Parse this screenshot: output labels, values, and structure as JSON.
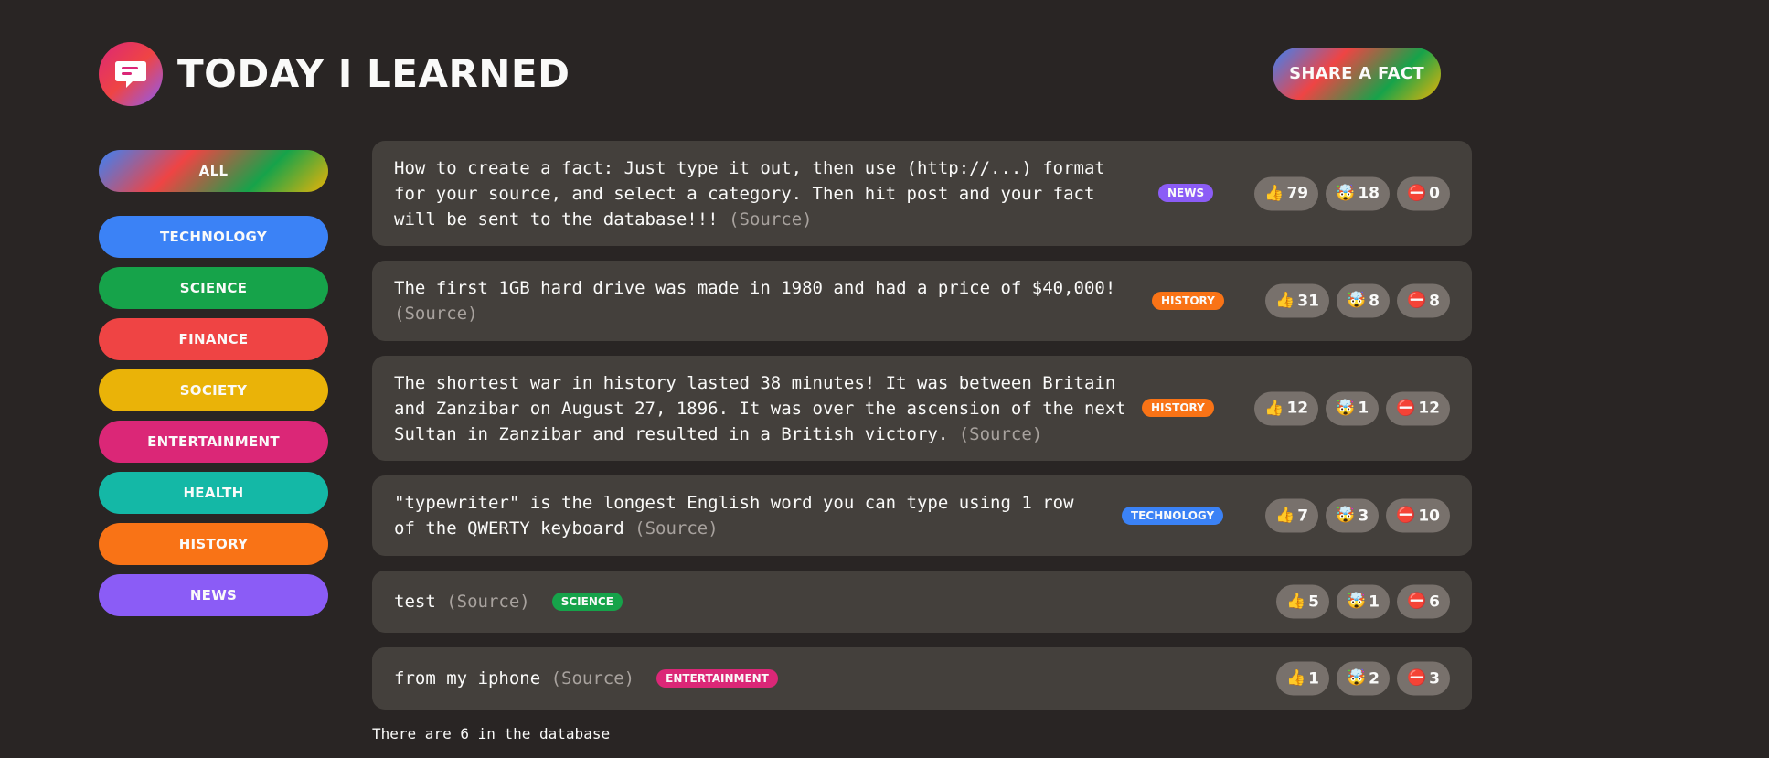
{
  "header": {
    "title": "TODAY I LEARNED",
    "share_button": "SHARE A FACT",
    "logo_icon": "speech-bubble-icon"
  },
  "categories": [
    {
      "name": "ALL",
      "color": "gradient"
    },
    {
      "name": "TECHNOLOGY",
      "color": "#3b82f6"
    },
    {
      "name": "SCIENCE",
      "color": "#16a34a"
    },
    {
      "name": "FINANCE",
      "color": "#ef4444"
    },
    {
      "name": "SOCIETY",
      "color": "#eab308"
    },
    {
      "name": "ENTERTAINMENT",
      "color": "#db2777"
    },
    {
      "name": "HEALTH",
      "color": "#14b8a6"
    },
    {
      "name": "HISTORY",
      "color": "#f97316"
    },
    {
      "name": "NEWS",
      "color": "#8b5cf6"
    }
  ],
  "facts": [
    {
      "text": "How to create a fact: Just type it out, then use (http://...) format for your source, and select a category. Then hit post and your fact will be sent to the database!!!",
      "source": "(Source)",
      "category": "NEWS",
      "category_color": "#8b5cf6",
      "votes_interesting": "79",
      "votes_mindblowing": "18",
      "votes_false": "0"
    },
    {
      "text": "The first 1GB hard drive was made in 1980 and had a price of $40,000!",
      "source": "(Source)",
      "category": "HISTORY",
      "category_color": "#f97316",
      "votes_interesting": "31",
      "votes_mindblowing": "8",
      "votes_false": "8"
    },
    {
      "text": "The shortest war in history lasted 38 minutes! It was between Britain and Zanzibar on August 27, 1896. It was over the ascension of the next Sultan in Zanzibar and resulted in a British victory.",
      "source": "(Source)",
      "category": "HISTORY",
      "category_color": "#f97316",
      "votes_interesting": "12",
      "votes_mindblowing": "1",
      "votes_false": "12"
    },
    {
      "text": "\"typewriter\" is the longest English word you can type using 1 row of the QWERTY keyboard",
      "source": "(Source)",
      "category": "TECHNOLOGY",
      "category_color": "#3b82f6",
      "votes_interesting": "7",
      "votes_mindblowing": "3",
      "votes_false": "10"
    },
    {
      "text": "test",
      "source": "(Source)",
      "category": "SCIENCE",
      "category_color": "#16a34a",
      "votes_interesting": "5",
      "votes_mindblowing": "1",
      "votes_false": "6"
    },
    {
      "text": "from my iphone",
      "source": "(Source)",
      "category": "ENTERTAINMENT",
      "category_color": "#db2777",
      "votes_interesting": "1",
      "votes_mindblowing": "2",
      "votes_false": "3"
    }
  ],
  "vote_icons": {
    "interesting": "thumbs-up-icon",
    "mindblowing": "mind-blown-icon",
    "false": "no-entry-icon"
  },
  "footer": {
    "count_text": "There are 6 in the database"
  }
}
